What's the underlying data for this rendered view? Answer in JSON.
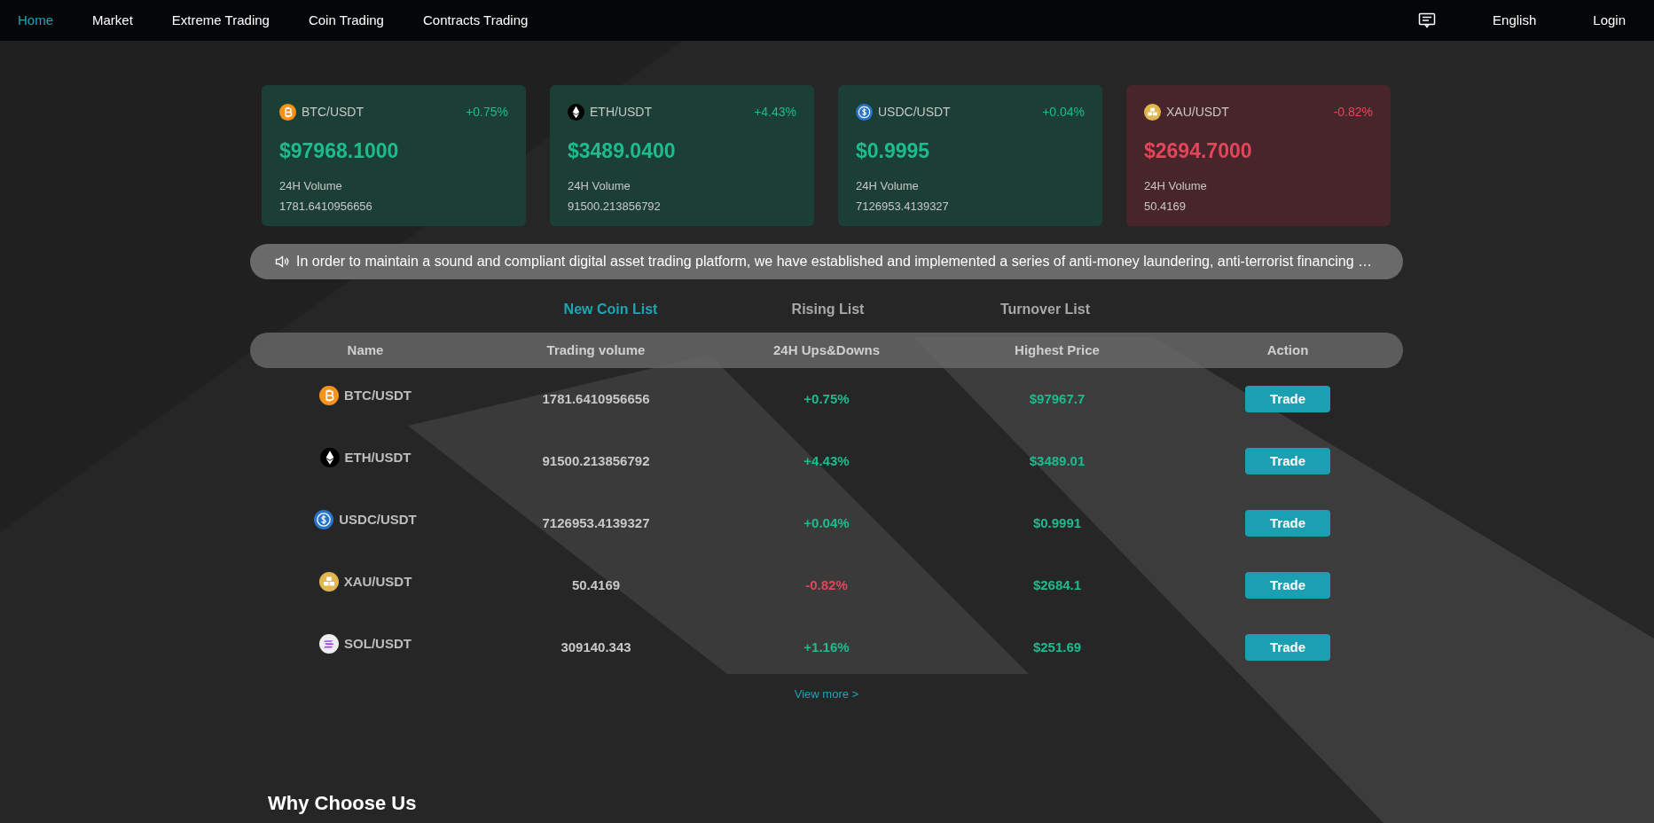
{
  "nav": {
    "items": [
      {
        "label": "Home",
        "selected": true
      },
      {
        "label": "Market",
        "selected": false
      },
      {
        "label": "Extreme Trading",
        "selected": false
      },
      {
        "label": "Coin Trading",
        "selected": false
      },
      {
        "label": "Contracts Trading",
        "selected": false
      }
    ],
    "language": "English",
    "login": "Login"
  },
  "cards": [
    {
      "pair": "BTC/USDT",
      "change": "+0.75%",
      "color": "#1dbb8d",
      "price": "$97968.1000",
      "volume_label": "24H Volume",
      "volume": "1781.6410956656"
    },
    {
      "pair": "ETH/USDT",
      "change": "+4.43%",
      "color": "#1dbb8d",
      "price": "$3489.0400",
      "volume_label": "24H Volume",
      "volume": "91500.213856792"
    },
    {
      "pair": "USDC/USDT",
      "change": "+0.04%",
      "color": "#1dbb8d",
      "price": "$0.9995",
      "volume_label": "24H Volume",
      "volume": "7126953.4139327"
    },
    {
      "pair": "XAU/USDT",
      "change": "-0.82%",
      "color": "#e2465b",
      "price": "$2694.7000",
      "volume_label": "24H Volume",
      "volume": "50.4169"
    }
  ],
  "notice": "In order to maintain a sound and compliant digital asset trading platform, we have established and implemented a series of anti-money laundering, anti-terrorist financing …",
  "list_tabs": [
    {
      "label": "New Coin List",
      "selected": true
    },
    {
      "label": "Rising List",
      "selected": false
    },
    {
      "label": "Turnover List",
      "selected": false
    }
  ],
  "table": {
    "columns": [
      "Name",
      "Trading volume",
      "24H Ups&Downs",
      "Highest Price",
      "Action"
    ],
    "rows": [
      {
        "pair": "BTC/USDT",
        "volume": "1781.6410956656",
        "change": "+0.75%",
        "color": "#1dbb8d",
        "high": "$97967.7",
        "action": "Trade"
      },
      {
        "pair": "ETH/USDT",
        "volume": "91500.213856792",
        "change": "+4.43%",
        "color": "#1dbb8d",
        "high": "$3489.01",
        "action": "Trade"
      },
      {
        "pair": "USDC/USDT",
        "volume": "7126953.4139327",
        "change": "+0.04%",
        "color": "#1dbb8d",
        "high": "$0.9991",
        "action": "Trade"
      },
      {
        "pair": "XAU/USDT",
        "volume": "50.4169",
        "change": "-0.82%",
        "color": "#e2465b",
        "high": "$2684.1",
        "action": "Trade"
      },
      {
        "pair": "SOL/USDT",
        "volume": "309140.343",
        "change": "+1.16%",
        "color": "#1dbb8d",
        "high": "$251.69",
        "action": "Trade"
      }
    ]
  },
  "view_more": "View more >",
  "section_title": "Why Choose Us"
}
